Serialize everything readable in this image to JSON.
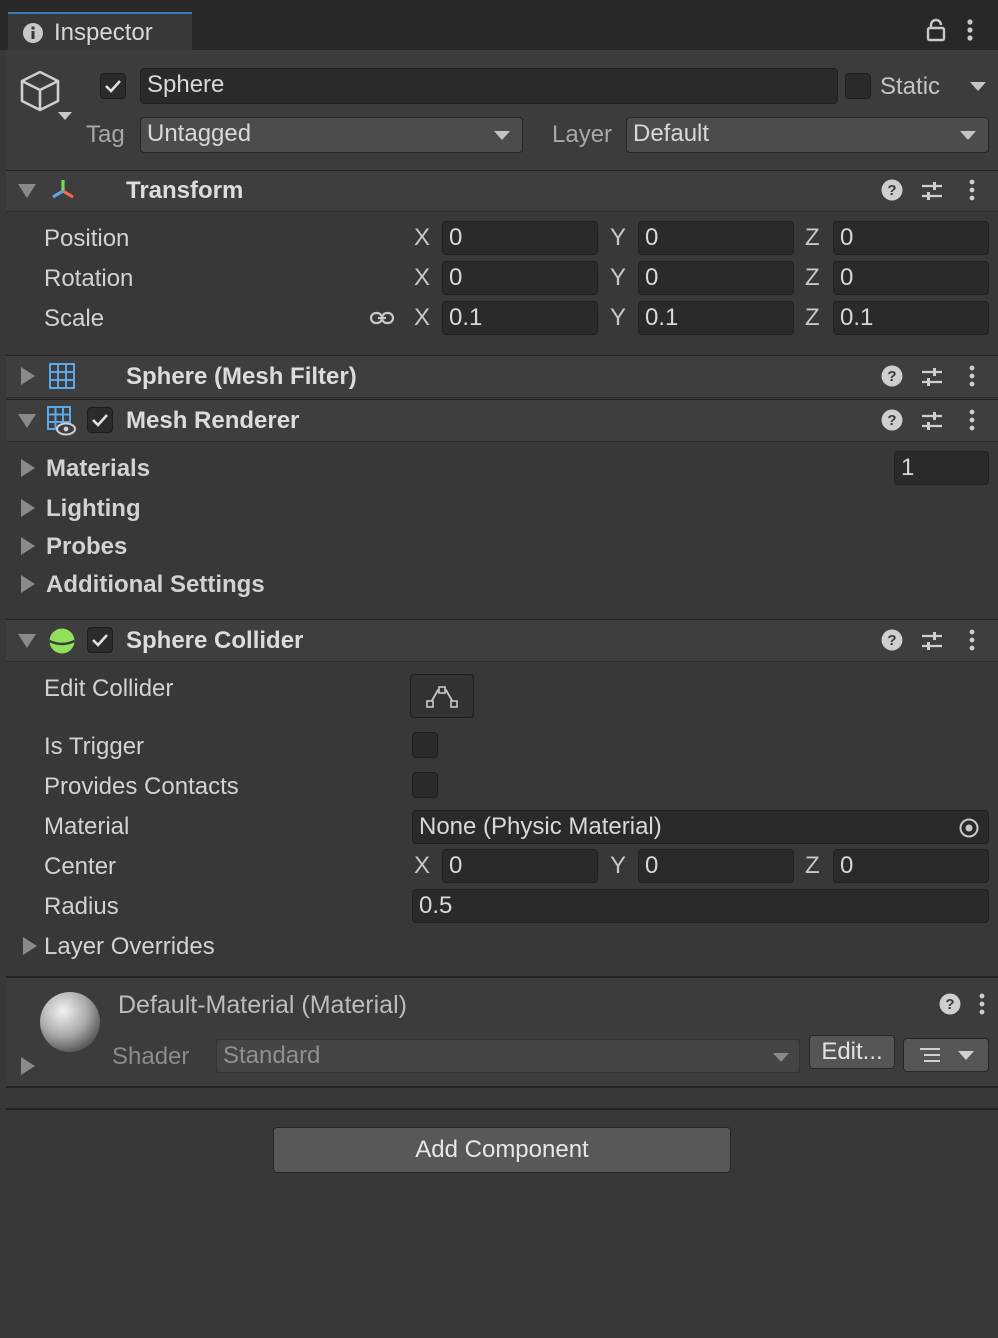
{
  "window": {
    "tab_label": "Inspector",
    "icons": {
      "info": "info-icon",
      "lock": "lock-icon",
      "menu": "kebab-menu-icon"
    }
  },
  "gameobject": {
    "active": true,
    "name": "Sphere",
    "static_label": "Static",
    "static_checked": false,
    "tag_label": "Tag",
    "tag_value": "Untagged",
    "layer_label": "Layer",
    "layer_value": "Default"
  },
  "transform": {
    "title": "Transform",
    "rows": [
      {
        "label": "Position",
        "x": "0",
        "y": "0",
        "z": "0"
      },
      {
        "label": "Rotation",
        "x": "0",
        "y": "0",
        "z": "0"
      },
      {
        "label": "Scale",
        "x": "0.1",
        "y": "0.1",
        "z": "0.1"
      }
    ],
    "axis_labels": {
      "x": "X",
      "y": "Y",
      "z": "Z"
    }
  },
  "mesh_filter": {
    "title": "Sphere (Mesh Filter)"
  },
  "mesh_renderer": {
    "title": "Mesh Renderer",
    "enabled": true,
    "materials_label": "Materials",
    "materials_count": "1",
    "sections": [
      "Lighting",
      "Probes",
      "Additional Settings"
    ]
  },
  "sphere_collider": {
    "title": "Sphere Collider",
    "enabled": true,
    "edit_collider_label": "Edit Collider",
    "is_trigger_label": "Is Trigger",
    "is_trigger": false,
    "provides_contacts_label": "Provides Contacts",
    "provides_contacts": false,
    "material_label": "Material",
    "material_value": "None (Physic Material)",
    "center_label": "Center",
    "center": {
      "x": "0",
      "y": "0",
      "z": "0"
    },
    "radius_label": "Radius",
    "radius_value": "0.5",
    "layer_overrides_label": "Layer Overrides"
  },
  "material": {
    "title": "Default-Material (Material)",
    "shader_label": "Shader",
    "shader_value": "Standard",
    "edit_label": "Edit..."
  },
  "add_component_label": "Add Component",
  "colors": {
    "panel": "#383838",
    "header": "#3e3e3e",
    "field": "#2a2a2a",
    "collider_green": "#8fe05a"
  }
}
